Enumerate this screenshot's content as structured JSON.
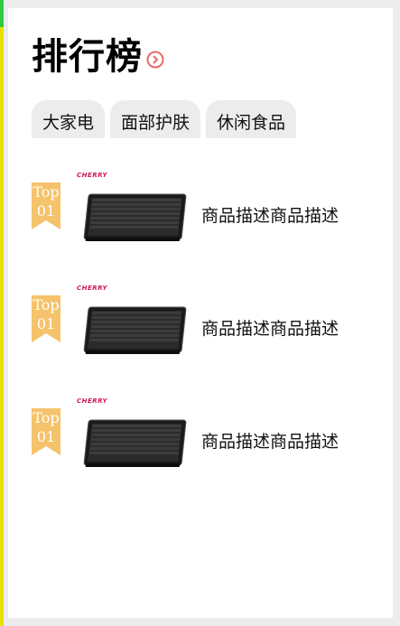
{
  "header": {
    "title": "排行榜",
    "more_icon": "chevron-right-circle-icon",
    "accent": "#e86a6a"
  },
  "tabs": [
    {
      "label": "大家电"
    },
    {
      "label": "面部护肤"
    },
    {
      "label": "休闲食品"
    }
  ],
  "items": [
    {
      "rank_top": "Top",
      "rank_num": "01",
      "brand": "CHERRY",
      "description": "商品描述商品描述",
      "image": "keyboard-image"
    },
    {
      "rank_top": "Top",
      "rank_num": "01",
      "brand": "CHERRY",
      "description": "商品描述商品描述",
      "image": "keyboard-image"
    },
    {
      "rank_top": "Top",
      "rank_num": "01",
      "brand": "CHERRY",
      "description": "商品描述商品描述",
      "image": "keyboard-image"
    }
  ],
  "colors": {
    "badge": "#f5c36b",
    "tab_bg": "#ececec",
    "page_bg": "#ececec"
  }
}
